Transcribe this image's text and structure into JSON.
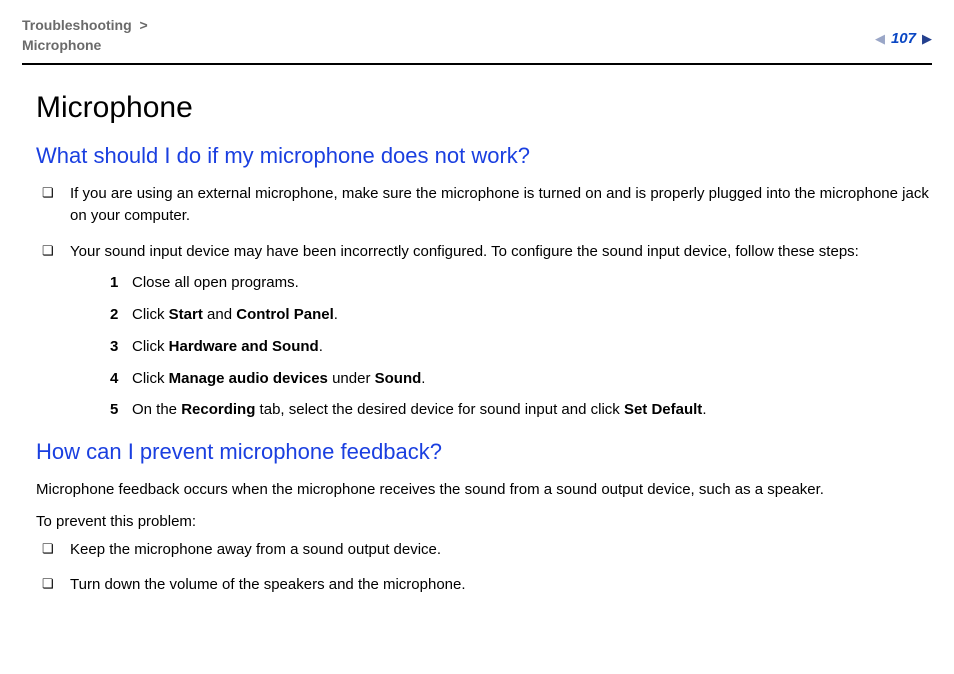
{
  "breadcrumb": {
    "a": "Troubleshooting",
    "sep": ">",
    "b": "Microphone"
  },
  "page_number": "107",
  "title": "Microphone",
  "sections": [
    {
      "heading": "What should I do if my microphone does not work?",
      "bullets": [
        {
          "text": "If you are using an external microphone, make sure the microphone is turned on and is properly plugged into the microphone jack on your computer."
        },
        {
          "text": "Your sound input device may have been incorrectly configured. To configure the sound input device, follow these steps:"
        }
      ],
      "steps": [
        {
          "pre": "Close all open programs."
        },
        {
          "pre": "Click ",
          "b1": "Start",
          "mid1": " and ",
          "b2": "Control Panel",
          "post": "."
        },
        {
          "pre": "Click ",
          "b1": "Hardware and Sound",
          "post": "."
        },
        {
          "pre": "Click ",
          "b1": "Manage audio devices",
          "mid1": " under ",
          "b2": "Sound",
          "post": "."
        },
        {
          "pre": "On the ",
          "b1": "Recording",
          "mid1": " tab, select the desired device for sound input and click ",
          "b2": "Set Default",
          "post": "."
        }
      ]
    },
    {
      "heading": "How can I prevent microphone feedback?",
      "paras": [
        "Microphone feedback occurs when the microphone receives the sound from a sound output device, such as a speaker.",
        "To prevent this problem:"
      ],
      "bullets": [
        {
          "text": "Keep the microphone away from a sound output device."
        },
        {
          "text": "Turn down the volume of the speakers and the microphone."
        }
      ]
    }
  ]
}
